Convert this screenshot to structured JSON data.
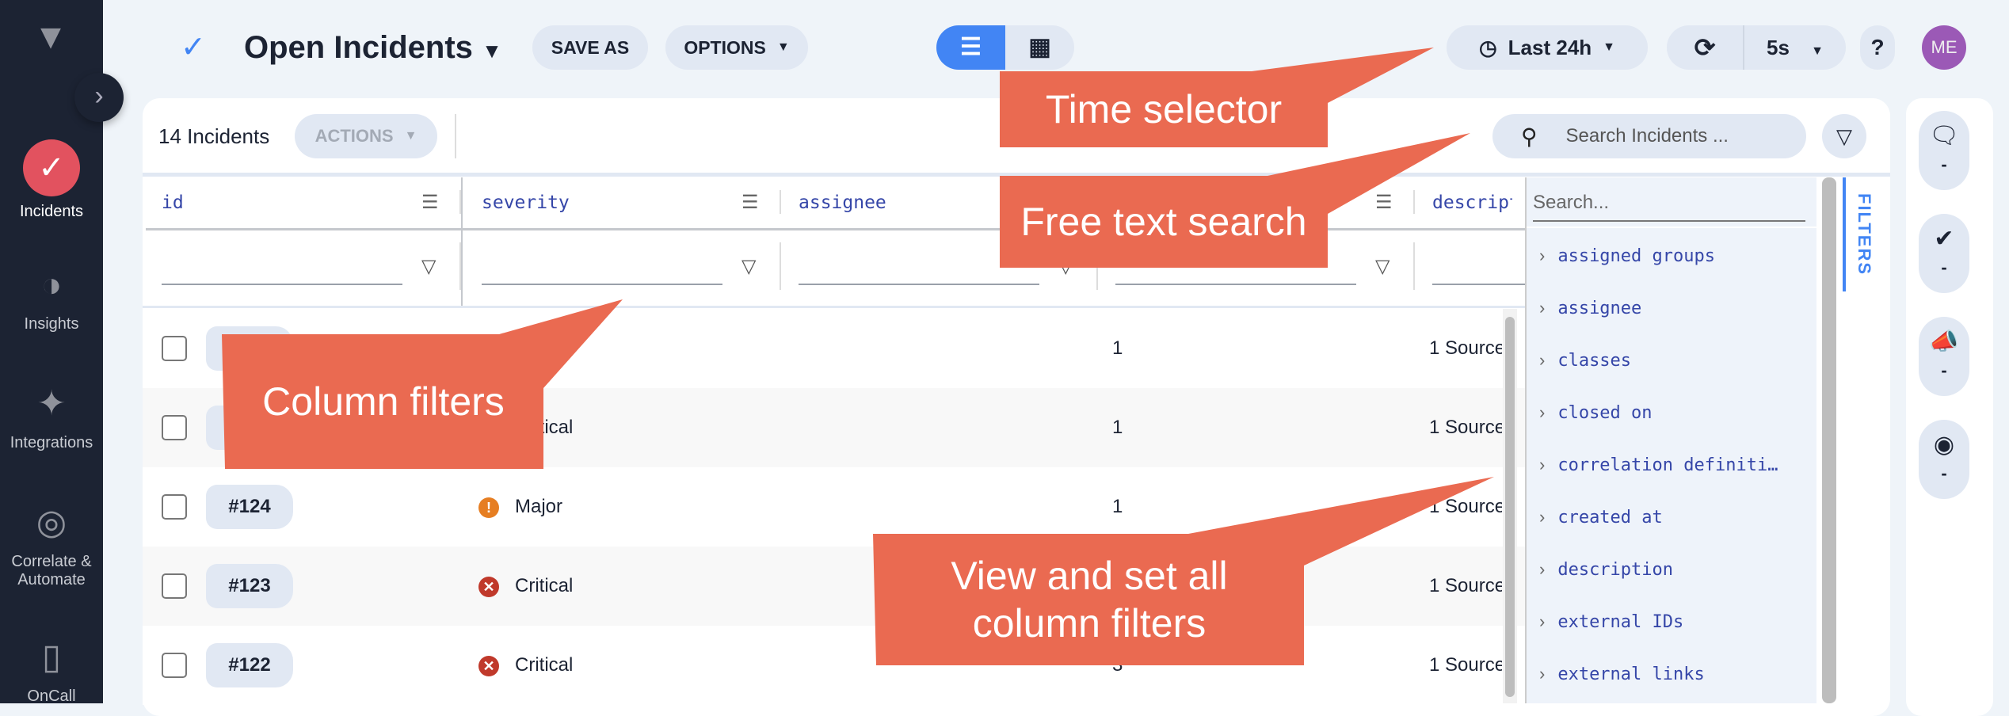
{
  "sidebar": {
    "items": [
      {
        "label": "Incidents",
        "icon": "incidents-icon",
        "active": true
      },
      {
        "label": "Insights",
        "icon": "pie-chart-icon"
      },
      {
        "label": "Integrations",
        "icon": "integrations-icon"
      },
      {
        "label": "Correlate & Automate",
        "icon": "radar-icon"
      },
      {
        "label": "OnCall",
        "icon": "phone-icon"
      }
    ]
  },
  "header": {
    "title": "Open Incidents",
    "save_as": "SAVE AS",
    "options": "OPTIONS",
    "time_range": "Last 24h",
    "refresh_interval": "5s",
    "help": "?",
    "avatar": "ME",
    "avatar_color": "#9b59b6",
    "accent": "#4285f4"
  },
  "toolbar": {
    "count": "14 Incidents",
    "actions": "ACTIONS",
    "search_placeholder": "Search Incidents ..."
  },
  "table": {
    "columns": [
      "id",
      "severity",
      "assignee",
      "",
      "descripti"
    ],
    "rows": [
      {
        "id": "",
        "severity": "Major",
        "c4": "1",
        "description": "1 Source"
      },
      {
        "id": "",
        "severity": "Critical",
        "c4": "1",
        "description": "1 Source"
      },
      {
        "id": "#124",
        "severity": "Major",
        "c4": "1",
        "description": "1 Source"
      },
      {
        "id": "#123",
        "severity": "Critical",
        "c4": "",
        "description": "1 Source"
      },
      {
        "id": "#122",
        "severity": "Critical",
        "c4": "3",
        "description": "1 Source"
      }
    ]
  },
  "severity_colors": {
    "Major": "#e67e22",
    "Critical": "#c0392b"
  },
  "filters_panel": {
    "search_placeholder": "Search...",
    "tab_label": "FILTERS",
    "items": [
      "assigned groups",
      "assignee",
      "classes",
      "closed on",
      "correlation definiti…",
      "created at",
      "description",
      "external IDs",
      "external links"
    ]
  },
  "right_rail": [
    {
      "icon": "chat-icon",
      "value": "-"
    },
    {
      "icon": "verified-icon",
      "value": "-"
    },
    {
      "icon": "megaphone-icon",
      "value": "-"
    },
    {
      "icon": "eye-icon",
      "value": "-"
    }
  ],
  "callouts": {
    "time": "Time selector",
    "search": "Free text search",
    "columns": "Column filters",
    "all_filters": "View and set all column filters"
  },
  "callout_color": "#ea6a51"
}
